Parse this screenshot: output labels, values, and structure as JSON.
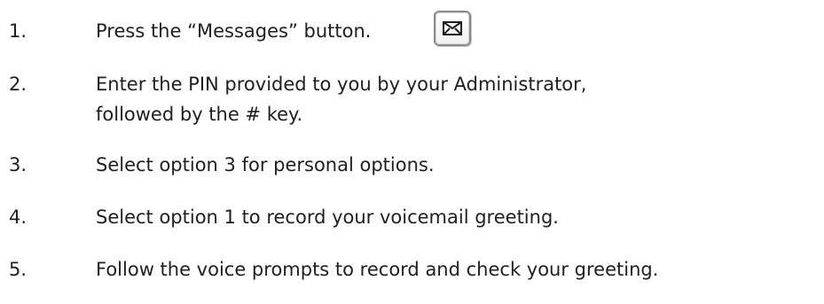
{
  "steps": [
    {
      "number": "1.",
      "text": "Press the “Messages” button."
    },
    {
      "number": "2.",
      "text_line_1": "Enter the PIN provided to you by your Administrator,",
      "text_line_2": "followed by the # key."
    },
    {
      "number": "3.",
      "text": "Select option 3 for personal options."
    },
    {
      "number": "4.",
      "text": "Select option 1 to record your voicemail greeting."
    },
    {
      "number": "5.",
      "text": "Follow the voice prompts to record and check your greeting."
    }
  ],
  "messages_button": {
    "icon": "envelope-icon",
    "color": "#1f1f1f",
    "border_color": "#8a8a8a"
  }
}
